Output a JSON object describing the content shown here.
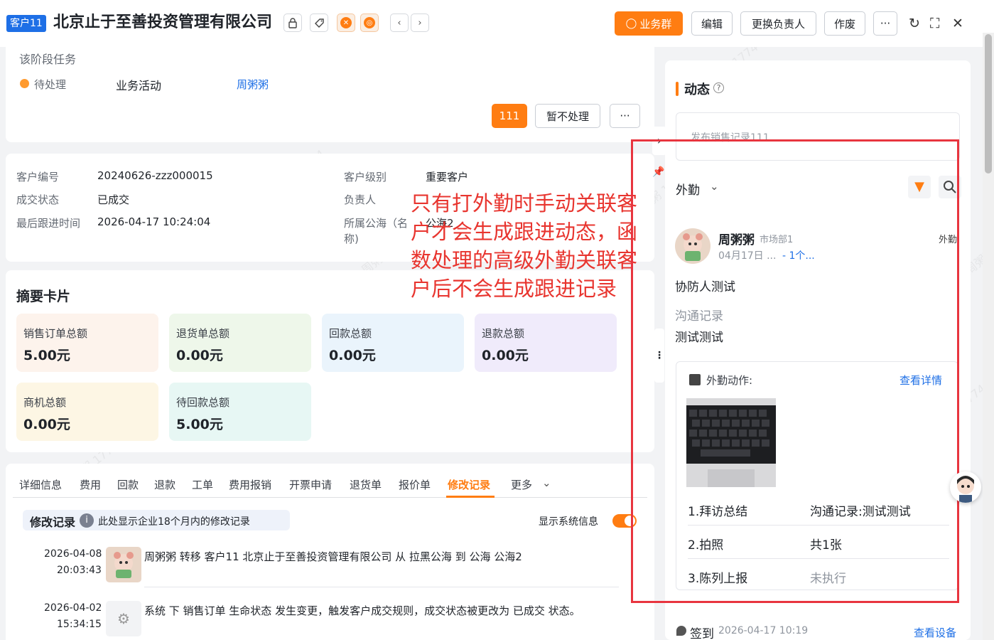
{
  "header": {
    "customer_tag": "客户11",
    "company_name": "北京止于至善投资管理有限公司",
    "btn_business_group": "业务群",
    "btn_edit": "编辑",
    "btn_change_owner": "更换负责人",
    "btn_void": "作废",
    "btn_more": "···"
  },
  "stage_task": {
    "title": "该阶段任务",
    "status": "待处理",
    "activity": "业务活动",
    "person": "周粥粥",
    "btn_111": "111",
    "btn_skip": "暂不处理",
    "btn_more": "···"
  },
  "info": {
    "customer_no_label": "客户编号",
    "customer_no": "20240626-zzz000015",
    "deal_status_label": "成交状态",
    "deal_status": "已成交",
    "last_follow_label": "最后跟进时间",
    "last_follow": "2026-04-17 10:24:04",
    "level_label": "客户级别",
    "level": "重要客户",
    "owner_label": "负责人",
    "sea_label_1": "所属公海（名",
    "sea_label_2": "称)",
    "sea": "公海2"
  },
  "summary": {
    "title": "摘要卡片",
    "items": [
      {
        "label": "销售订单总额",
        "value": "5.00元",
        "bg": "#fdf3ec"
      },
      {
        "label": "退货单总额",
        "value": "0.00元",
        "bg": "#eef7ea"
      },
      {
        "label": "回款总额",
        "value": "0.00元",
        "bg": "#eaf4fc"
      },
      {
        "label": "退款总额",
        "value": "0.00元",
        "bg": "#f0ebfb"
      },
      {
        "label": "商机总额",
        "value": "0.00元",
        "bg": "#fdf6e4"
      },
      {
        "label": "待回款总额",
        "value": "5.00元",
        "bg": "#e7f7f4"
      }
    ]
  },
  "tabs": [
    "详细信息",
    "费用",
    "回款",
    "退款",
    "工单",
    "费用报销",
    "开票申请",
    "退货单",
    "报价单",
    "修改记录",
    "更多"
  ],
  "modify": {
    "title": "修改记录",
    "note": "此处显示企业18个月内的修改记录",
    "sys_info": "显示系统信息",
    "records": [
      {
        "date": "2026-04-08",
        "time": "20:03:43",
        "text": "周粥粥 转移 客户11 北京止于至善投资管理有限公司 从 拉黑公海 到 公海 公海2"
      },
      {
        "date": "2026-04-02",
        "time": "15:34:15",
        "text": "系统 下 销售订单 生命状态 发生变更，触发客户成交规则，成交状态被更改为 已成交 状态。"
      }
    ]
  },
  "annotation": "只有打外勤时手动关联客户才会生成跟进动态，函数处理的高级外勤关联客户后不会生成跟进记录",
  "dynamic": {
    "title": "动态",
    "post_placeholder": "发布销售记录111",
    "filter": "外勤",
    "user": "周粥粥",
    "dept": "市场部1",
    "meta_date": "04月17日 ...",
    "meta_link": "- 1个...",
    "type_tag": "外勤",
    "content": "协防人测试",
    "comm_label": "沟通记录",
    "comm_value": "测试测试",
    "action_title": "外勤动作:",
    "view_detail": "查看详情",
    "actions": [
      {
        "name": "1.拜访总结",
        "value": "沟通记录:测试测试"
      },
      {
        "name": "2.拍照",
        "value": "共1张"
      },
      {
        "name": "3.陈列上报",
        "value": "未执行"
      }
    ],
    "signin_label": "签到",
    "signin_time": "2026-04-17 10:19",
    "view_device": "查看设备"
  },
  "watermark": "周粥粥 1774"
}
